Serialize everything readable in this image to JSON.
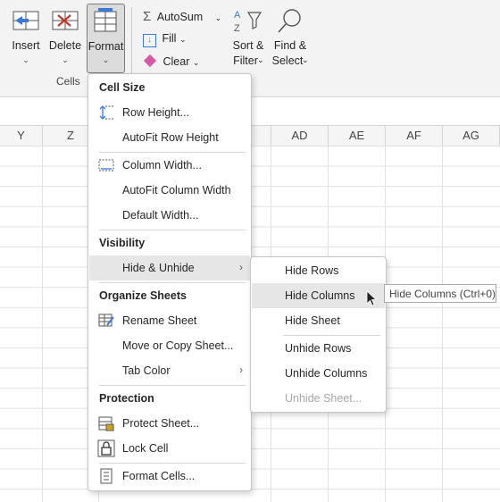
{
  "ribbon": {
    "insert_label": "Insert",
    "delete_label": "Delete",
    "format_label": "Format",
    "cells_group_label": "Cells",
    "autosum_label": "AutoSum",
    "fill_label": "Fill",
    "clear_label": "Clear",
    "sort_line1": "Sort &",
    "sort_line2": "Filter",
    "find_line1": "Find &",
    "find_line2": "Select"
  },
  "columns": [
    "Y",
    "Z",
    "AD",
    "AE",
    "AF",
    "AG"
  ],
  "format_menu": {
    "cell_size_header": "Cell Size",
    "row_height": "Row Height...",
    "autofit_row_height": "AutoFit Row Height",
    "column_width": "Column Width...",
    "autofit_column_width": "AutoFit Column Width",
    "default_width": "Default Width...",
    "visibility_header": "Visibility",
    "hide_unhide": "Hide & Unhide",
    "organize_header": "Organize Sheets",
    "rename_sheet": "Rename Sheet",
    "move_copy_sheet": "Move or Copy Sheet...",
    "tab_color": "Tab Color",
    "protection_header": "Protection",
    "protect_sheet": "Protect Sheet...",
    "lock_cell": "Lock Cell",
    "format_cells": "Format Cells..."
  },
  "hide_submenu": {
    "hide_rows": "Hide Rows",
    "hide_columns": "Hide Columns",
    "hide_sheet": "Hide Sheet",
    "unhide_rows": "Unhide Rows",
    "unhide_columns": "Unhide Columns",
    "unhide_sheet": "Unhide Sheet..."
  },
  "tooltip": "Hide Columns (Ctrl+0)",
  "colors": {
    "accent": "#3c78d8",
    "highlight": "#e6e6e6",
    "ribbon_bg": "#f3f3f3"
  }
}
